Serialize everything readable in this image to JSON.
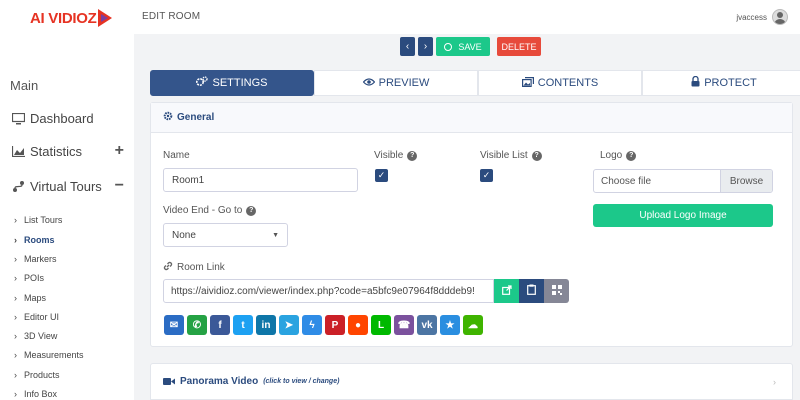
{
  "brand": {
    "logo_text": "AI VIDIOZ"
  },
  "header": {
    "page_title": "EDIT ROOM",
    "username": "jvaccess"
  },
  "toolbar": {
    "prev_label": "‹",
    "next_label": "›",
    "save_label": "SAVE",
    "delete_label": "DELETE"
  },
  "sidebar": {
    "section": "Main",
    "items": [
      {
        "label": "Dashboard",
        "icon": "monitor-icon"
      },
      {
        "label": "Statistics",
        "icon": "chart-area-icon",
        "toggle": "+"
      },
      {
        "label": "Virtual Tours",
        "icon": "route-icon",
        "toggle": "−"
      }
    ],
    "subitems": [
      "List Tours",
      "Rooms",
      "Markers",
      "POIs",
      "Maps",
      "Editor UI",
      "3D View",
      "Measurements",
      "Products",
      "Info Box"
    ],
    "active_subitem": "Rooms"
  },
  "tabs": [
    {
      "label": "SETTINGS",
      "icon": "cogs-icon",
      "active": true
    },
    {
      "label": "PREVIEW",
      "icon": "eye-icon",
      "active": false
    },
    {
      "label": "CONTENTS",
      "icon": "images-icon",
      "active": false
    },
    {
      "label": "PROTECT",
      "icon": "lock-icon",
      "active": false
    }
  ],
  "general": {
    "title": "General",
    "name_label": "Name",
    "name_value": "Room1",
    "visible_label": "Visible",
    "visible_list_label": "Visible List",
    "logo_label": "Logo",
    "file_placeholder": "Choose file",
    "browse_label": "Browse",
    "upload_label": "Upload Logo Image",
    "video_end_label": "Video End - Go to",
    "video_end_value": "None",
    "room_link_label": "Room Link",
    "room_link_value": "https://aividioz.com/viewer/index.php?code=a5bfc9e07964f8dddeb9!"
  },
  "share_buttons": [
    {
      "name": "email",
      "glyph": "✉",
      "color": "#2b6cc4"
    },
    {
      "name": "whatsapp",
      "glyph": "✆",
      "color": "#25a244"
    },
    {
      "name": "facebook",
      "glyph": "f",
      "color": "#3b5998"
    },
    {
      "name": "twitter",
      "glyph": "t",
      "color": "#1da1f2"
    },
    {
      "name": "linkedin",
      "glyph": "in",
      "color": "#0e76a8"
    },
    {
      "name": "telegram",
      "glyph": "➤",
      "color": "#2aa3e0"
    },
    {
      "name": "messenger",
      "glyph": "ϟ",
      "color": "#2f8ce6"
    },
    {
      "name": "pinterest",
      "glyph": "P",
      "color": "#cb2027"
    },
    {
      "name": "reddit",
      "glyph": "●",
      "color": "#ff4500"
    },
    {
      "name": "line",
      "glyph": "L",
      "color": "#00b900"
    },
    {
      "name": "viber",
      "glyph": "☎",
      "color": "#7b519d"
    },
    {
      "name": "vk",
      "glyph": "vk",
      "color": "#4c75a3"
    },
    {
      "name": "qzone",
      "glyph": "★",
      "color": "#2a8ee0"
    },
    {
      "name": "wechat",
      "glyph": "☁",
      "color": "#3fb400"
    }
  ],
  "panorama": {
    "title": "Panorama Video",
    "hint": "(click to view / change)"
  }
}
